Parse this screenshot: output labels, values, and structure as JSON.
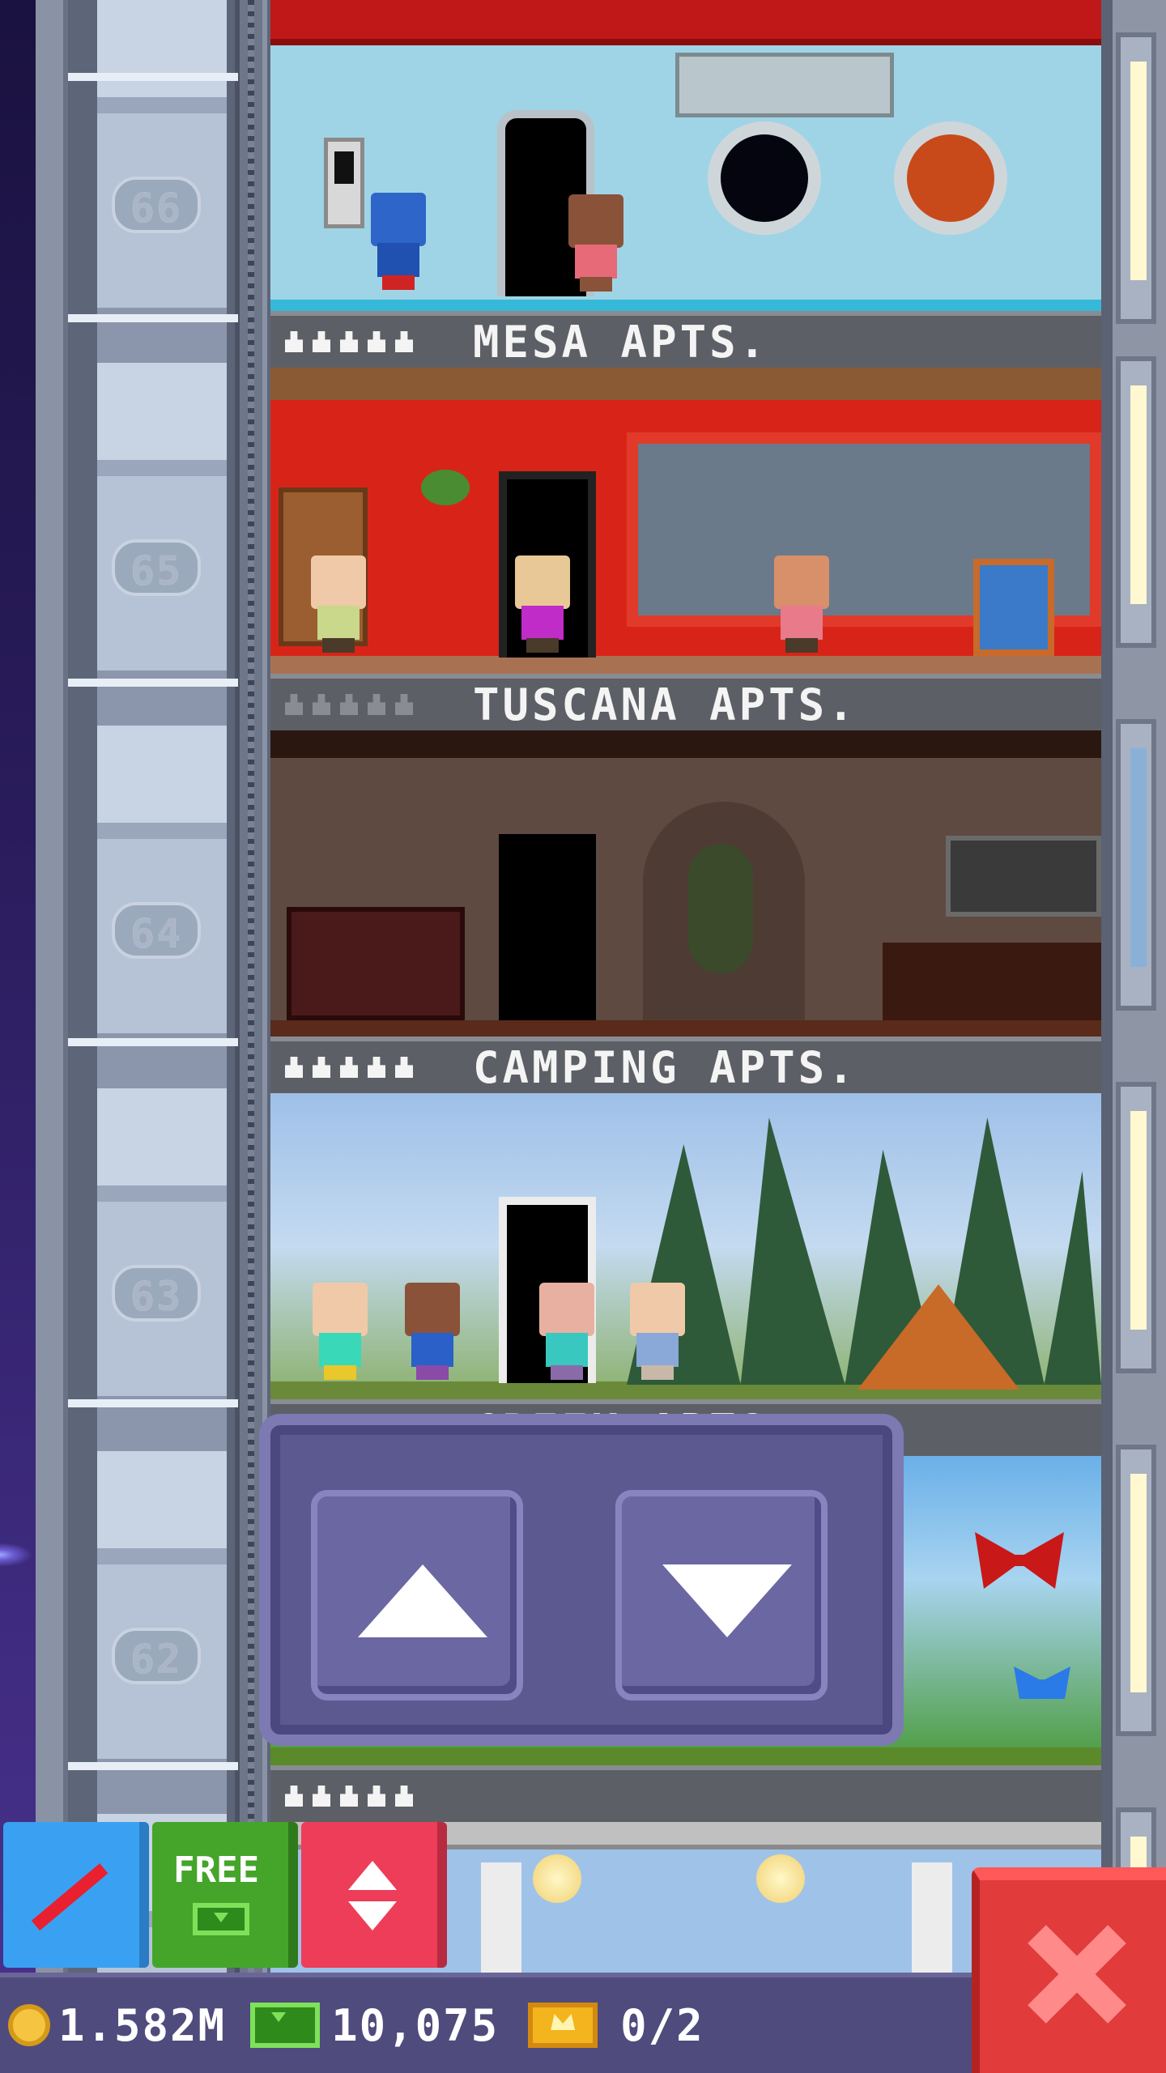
{
  "floors": [
    {
      "number": "66",
      "name": "MESA APTS.",
      "theme": "space-station",
      "residents_full": true
    },
    {
      "number": "65",
      "name": "TUSCANA APTS.",
      "theme": "red-tuscan",
      "residents_full": false
    },
    {
      "number": "64",
      "name": "CAMPING APTS.",
      "theme": "adobe",
      "residents_full": true
    },
    {
      "number": "63",
      "name": "GREEK APTS.",
      "theme": "forest-camping",
      "residents_full": true
    },
    {
      "number": "62",
      "name": "",
      "theme": "butterfly-garden",
      "residents_full": true
    }
  ],
  "hud": {
    "free_label": "FREE",
    "coins": "1.582M",
    "bux": "10,075",
    "tickets": "0/2"
  },
  "colors": {
    "coin": "#f5c542",
    "bux": "#2e8a1a",
    "close": "#e13b3b",
    "panel": "#5c5991"
  },
  "icons": {
    "elevator_up": "triangle-up",
    "elevator_down": "triangle-down",
    "close": "x-mark",
    "raffle": "arrow-icon",
    "free_bux": "cash-icon",
    "elevator": "up-down-icon"
  }
}
